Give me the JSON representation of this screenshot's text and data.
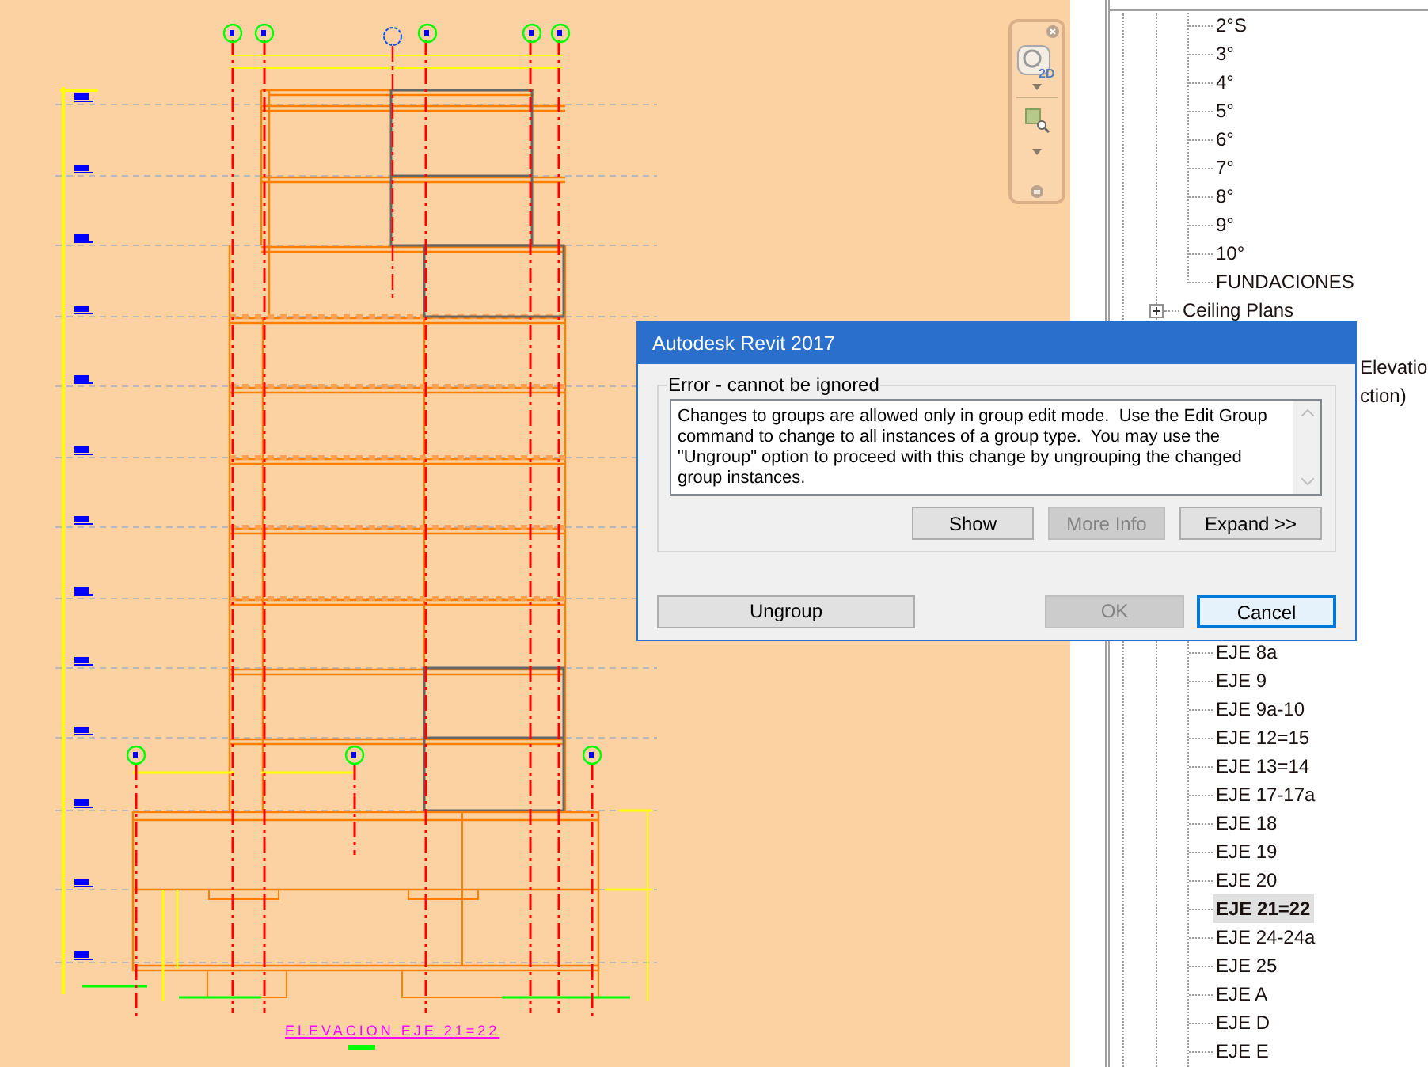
{
  "drawing": {
    "title": "ELEVACION EJE 21=22"
  },
  "navigation_bar": {
    "wheel_label": "2D"
  },
  "project_browser": {
    "floor_plan_views": [
      {
        "label": "2°S",
        "selected": false
      },
      {
        "label": "3°",
        "selected": false
      },
      {
        "label": "4°",
        "selected": false
      },
      {
        "label": "5°",
        "selected": false
      },
      {
        "label": "6°",
        "selected": false
      },
      {
        "label": "7°",
        "selected": false
      },
      {
        "label": "8°",
        "selected": false
      },
      {
        "label": "9°",
        "selected": false
      },
      {
        "label": "10°",
        "selected": false
      },
      {
        "label": "FUNDACIONES",
        "selected": false
      }
    ],
    "ceiling_plans": {
      "label": "Ceiling Plans",
      "expanded": false
    },
    "clipped_labels": [
      "Elevatio",
      "ction)"
    ],
    "elevation_views": [
      {
        "label": "EJE 8a",
        "selected": false
      },
      {
        "label": "EJE 9",
        "selected": false
      },
      {
        "label": "EJE 9a-10",
        "selected": false
      },
      {
        "label": "EJE 12=15",
        "selected": false
      },
      {
        "label": "EJE 13=14",
        "selected": false
      },
      {
        "label": "EJE 17-17a",
        "selected": false
      },
      {
        "label": "EJE 18",
        "selected": false
      },
      {
        "label": "EJE 19",
        "selected": false
      },
      {
        "label": "EJE 20",
        "selected": false
      },
      {
        "label": "EJE 21=22",
        "selected": true
      },
      {
        "label": "EJE 24-24a",
        "selected": false
      },
      {
        "label": "EJE 25",
        "selected": false
      },
      {
        "label": "EJE A",
        "selected": false
      },
      {
        "label": "EJE D",
        "selected": false
      },
      {
        "label": "EJE E",
        "selected": false
      }
    ]
  },
  "dialog": {
    "title": "Autodesk Revit 2017",
    "group_label": "Error - cannot be ignored",
    "message": "Changes to groups are allowed only in group edit mode.  Use the Edit Group command to change to all instances of a group type.  You may use the \"Ungroup\" option to proceed with this change by ungrouping the changed group instances.",
    "detail_buttons": [
      {
        "label": "Show",
        "disabled": false
      },
      {
        "label": "More Info",
        "disabled": true
      },
      {
        "label": "Expand >>",
        "disabled": false
      }
    ],
    "left_button": {
      "label": "Ungroup",
      "disabled": false
    },
    "footer_buttons": [
      {
        "label": "OK",
        "disabled": true,
        "focused": false
      },
      {
        "label": "Cancel",
        "disabled": false,
        "focused": true
      }
    ]
  }
}
